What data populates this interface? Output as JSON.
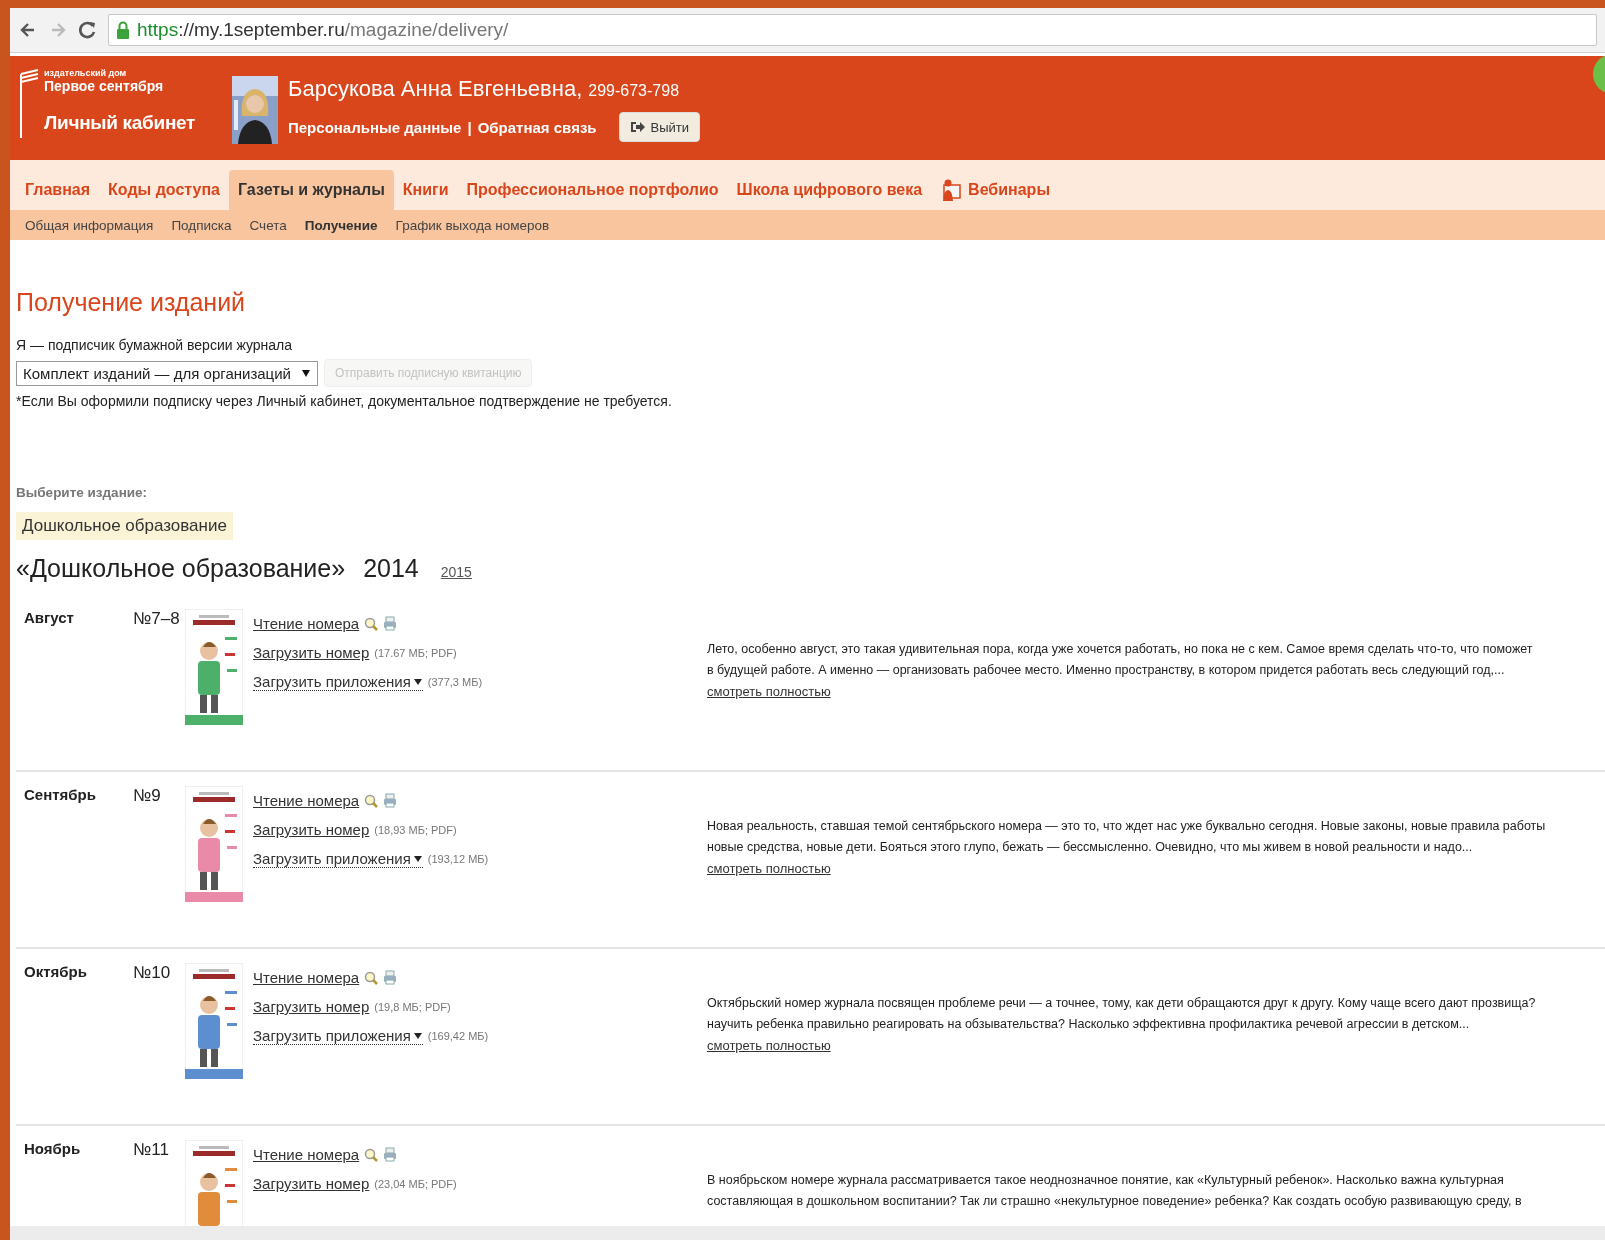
{
  "browser": {
    "url_scheme": "https",
    "url_host": "://my.1september.ru",
    "url_path": "/magazine/delivery/"
  },
  "header": {
    "logo": {
      "publisher_label": "издательский дом",
      "publisher_name": "Первое сентября",
      "cabinet": "Личный кабинет"
    },
    "user": {
      "name": "Барсукова Анна Евгеньевна,",
      "id": "299-673-798"
    },
    "links": [
      "Персональные данные",
      "Обратная связь"
    ],
    "separator": "|",
    "logout": "Выйти"
  },
  "nav": [
    {
      "label": "Главная",
      "selected": false,
      "has_icon": false
    },
    {
      "label": "Коды доступа",
      "selected": false,
      "has_icon": false
    },
    {
      "label": "Газеты и журналы",
      "selected": true,
      "has_icon": false
    },
    {
      "label": "Книги",
      "selected": false,
      "has_icon": false
    },
    {
      "label": "Профессиональное портфолио",
      "selected": false,
      "has_icon": false
    },
    {
      "label": "Школа цифрового века",
      "selected": false,
      "has_icon": false
    },
    {
      "label": "Вебинары",
      "selected": false,
      "has_icon": true
    }
  ],
  "subnav": [
    {
      "label": "Общая информация",
      "selected": false
    },
    {
      "label": "Подписка",
      "selected": false
    },
    {
      "label": "Счета",
      "selected": false
    },
    {
      "label": "Получение",
      "selected": true
    },
    {
      "label": "График выхода номеров",
      "selected": false
    }
  ],
  "page": {
    "title": "Получение изданий",
    "subscriber_label": "Я — подписчик бумажной версии журнала",
    "select": {
      "value": "Комплект изданий — для организаций"
    },
    "send_button": {
      "label": "Отправить подписную квитанцию",
      "disabled": true
    },
    "note": "*Если Вы оформили подписку через Личный кабинет, документальное подтверждение не требуется.",
    "choose_label": "Выберите издание:",
    "edition_tag": "Дошкольное образование",
    "heading": {
      "title": "«Дошкольное образование»",
      "year": "2014",
      "other_year": "2015"
    }
  },
  "issues": [
    {
      "month": "Август",
      "number": "№7–8",
      "read_link": "Чтение номера",
      "download_link": "Загрузить номер",
      "download_size": "(17.67 МБ; PDF)",
      "attachments_link": "Загрузить приложения",
      "attachments_size": "(377,3 МБ)",
      "description_lines": [
        "Лето, особенно август, это такая удивительная пора, когда уже хочется работать, но пока не с кем. Самое время сделать что-то, что поможет",
        "в будущей работе. А именно — организовать рабочее место. Именно пространству, в котором придется работать весь следующий год,..."
      ],
      "more_link": "смотреть полностью"
    },
    {
      "month": "Сентябрь",
      "number": "№9",
      "read_link": "Чтение номера",
      "download_link": "Загрузить номер",
      "download_size": "(18,93 МБ; PDF)",
      "attachments_link": "Загрузить приложения",
      "attachments_size": "(193,12 МБ)",
      "description_lines": [
        "Новая реальность, ставшая темой сентябрьского номера — это то, что ждет нас уже буквально сегодня. Новые законы, новые правила работы",
        "новые средства, новые дети. Бояться этого глупо, бежать — бессмысленно. Очевидно, что мы живем в новой реальности и надо..."
      ],
      "more_link": "смотреть полностью"
    },
    {
      "month": "Октябрь",
      "number": "№10",
      "read_link": "Чтение номера",
      "download_link": "Загрузить номер",
      "download_size": "(19,8 МБ; PDF)",
      "attachments_link": "Загрузить приложения",
      "attachments_size": "(169,42 МБ)",
      "description_lines": [
        "Октябрьский номер журнала посвящен проблеме речи — а точнее, тому, как дети обращаются друг к другу. Кому чаще всего дают прозвища?",
        "научить ребенка правильно реагировать на обзывательства? Насколько эффективна профилактика речевой агрессии в детском..."
      ],
      "more_link": "смотреть полностью"
    },
    {
      "month": "Ноябрь",
      "number": "№11",
      "read_link": "Чтение номера",
      "download_link": "Загрузить номер",
      "download_size": "(23,04 МБ; PDF)",
      "description_lines": [
        "В ноябрьском номере журнала рассматривается такое неоднозначное понятие, как «Культурный ребенок». Насколько важна культурная",
        "составляющая в дошкольном воспитании? Так ли страшно «некультурное поведение» ребенка? Как создать особую развивающую среду, в"
      ]
    }
  ]
}
